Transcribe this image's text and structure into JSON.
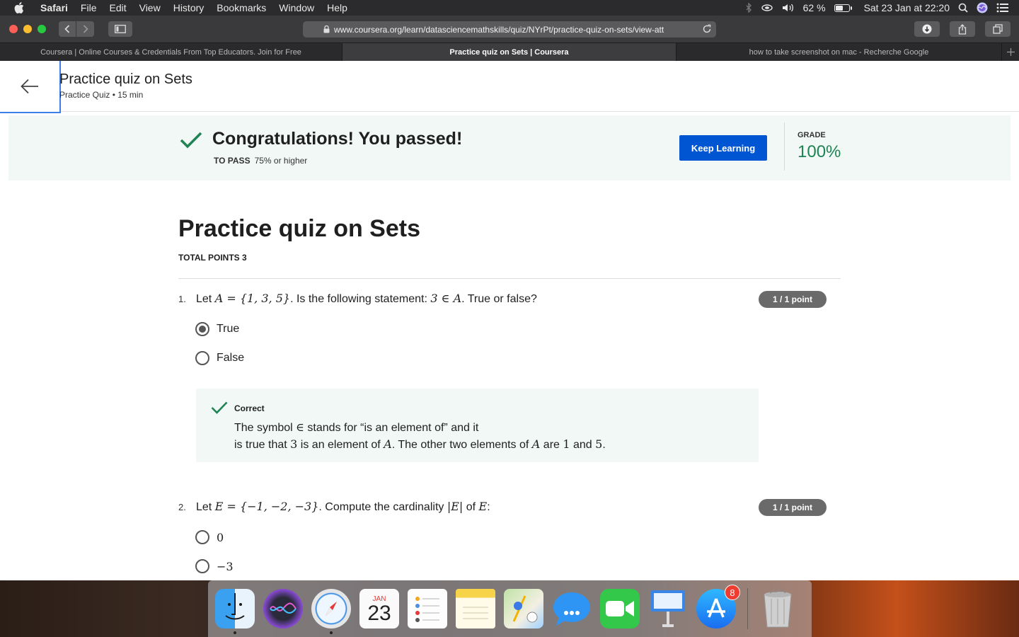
{
  "menubar": {
    "app_name": "Safari",
    "items": [
      "File",
      "Edit",
      "View",
      "History",
      "Bookmarks",
      "Window",
      "Help"
    ],
    "battery": "62 %",
    "battery_level": 0.62,
    "datetime": "Sat 23 Jan at  22:20"
  },
  "browser": {
    "url": "www.coursera.org/learn/datasciencemathskills/quiz/NYrPt/practice-quiz-on-sets/view-att",
    "tabs": [
      {
        "label": "Coursera | Online Courses & Credentials From Top Educators. Join for Free",
        "active": false
      },
      {
        "label": "Practice quiz on Sets | Coursera",
        "active": true
      },
      {
        "label": "how to take screenshot on mac - Recherche Google",
        "active": false
      }
    ]
  },
  "header": {
    "title": "Practice quiz on Sets",
    "subtitle": "Practice Quiz • 15 min"
  },
  "banner": {
    "heading": "Congratulations! You passed!",
    "to_pass_label": "TO PASS",
    "to_pass_value": "75% or higher",
    "button": "Keep Learning",
    "grade_label": "GRADE",
    "grade_value": "100%"
  },
  "quiz": {
    "title": "Practice quiz on Sets",
    "total_points": "TOTAL POINTS 3",
    "questions": [
      {
        "number": "1.",
        "text_parts": [
          "Let ",
          "A = {1, 3, 5}",
          ". Is the following statement:  ",
          "3 ∈ A",
          ".  True or false?"
        ],
        "points": "1 / 1 point",
        "options": [
          {
            "label": "True",
            "selected": true
          },
          {
            "label": "False",
            "selected": false
          }
        ],
        "feedback": {
          "label": "Correct",
          "line1_parts": [
            "The symbol ",
            "∈",
            " stands for “is an element of” and it"
          ],
          "line2_parts": [
            "is true that ",
            "3",
            " is an element of ",
            "A",
            ". The other two elements of ",
            "A",
            " are ",
            "1",
            " and ",
            "5",
            "."
          ]
        }
      },
      {
        "number": "2.",
        "text_parts": [
          "Let ",
          "E = {−1, −2, −3}",
          ". Compute the cardinality ",
          "|E|",
          " of ",
          "E",
          ":"
        ],
        "points": "1 / 1 point",
        "options": [
          {
            "label": "0",
            "selected": false
          },
          {
            "label": "−3",
            "selected": false
          }
        ]
      }
    ]
  },
  "dock": {
    "apps": [
      "finder-icon",
      "siri-icon",
      "safari-icon",
      "calendar-icon",
      "reminders-icon",
      "notes-icon",
      "maps-icon",
      "messages-icon",
      "facetime-icon",
      "keynote-icon",
      "app-store-icon",
      "trash-icon"
    ],
    "calendar_month": "JAN",
    "calendar_day": "23",
    "app_store_badge": "8"
  }
}
